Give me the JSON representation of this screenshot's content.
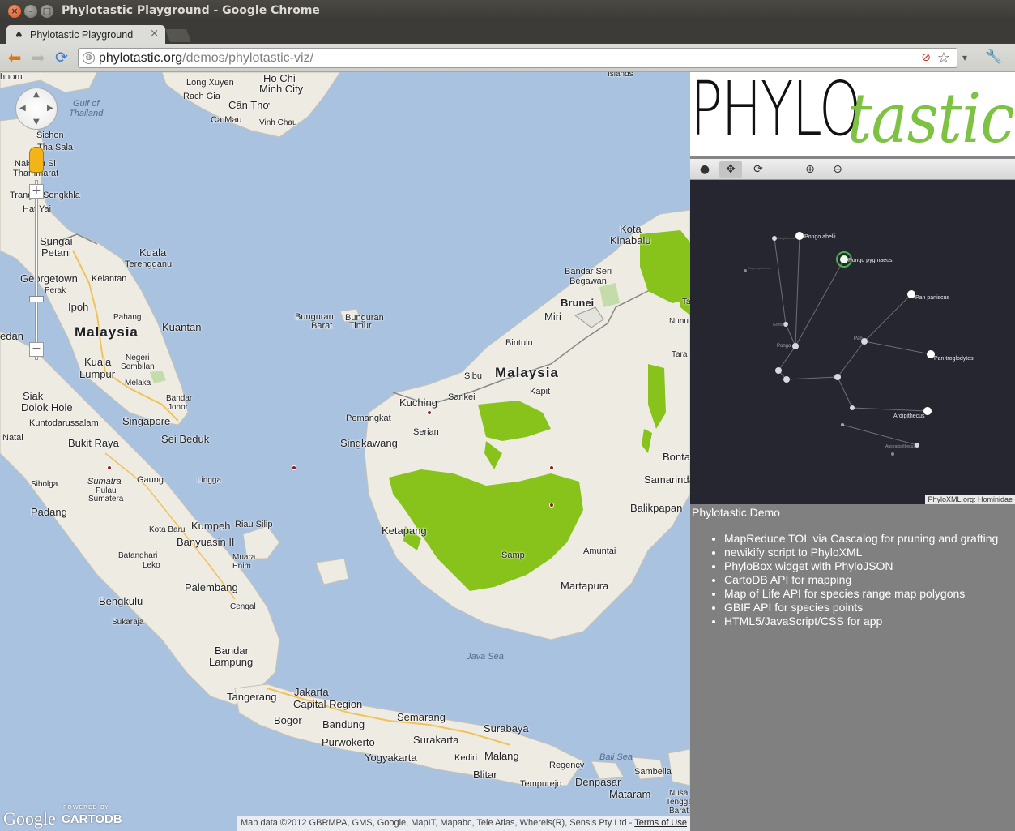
{
  "window": {
    "title": "Phylotastic Playground - Google Chrome",
    "close_glyph": "×",
    "min_glyph": "–",
    "max_glyph": "□"
  },
  "tab": {
    "label": "Phylotastic Playground",
    "icon": "tree-favicon",
    "close_glyph": "×"
  },
  "toolbar": {
    "url_host": "phylotastic.org",
    "url_path": "/demos/phylotastic-viz/",
    "back_glyph": "⬅",
    "forward_glyph": "➡",
    "reload_glyph": "⟳",
    "star_glyph": "☆",
    "dropdown_glyph": "▾",
    "wrench_glyph": "🔧"
  },
  "map": {
    "zoom_in": "+",
    "zoom_out": "−",
    "logo": "Google",
    "powered_by": "POWERED BY",
    "cartodb": "CARTODB",
    "attribution": "Map data ©2012 GBRMPA, GMS, Google, MapIT, Mapabc, Tele Atlas, Whereis(R), Sensis Pty Ltd - ",
    "terms": "Terms of Use",
    "labels": {
      "phnom": "hnom",
      "hochi": "Ho Chi",
      "minhcity": "Minh City",
      "longxuyen": "Long Xuyen",
      "rachgia": "Rach Gia",
      "cantho": "Cần Thơ",
      "camau": "Ca Mau",
      "vinhchau": "Vinh Chau",
      "islands": "Islands",
      "gulf": "Gulf of",
      "thailand": "Thailand",
      "sichon": "Sichon",
      "tasala": "Tha Sala",
      "nakhon": "Nakhon Si",
      "thammarat": "Thammarat",
      "trang": "Trang",
      "songkhla": "Songkhla",
      "hatyai": "Hat Yai",
      "sungai": "Sungai",
      "petani": "Petani",
      "kuala": "Kuala",
      "terengganu": "Terengganu",
      "georgetown": "Georgetown",
      "kelantan": "Kelantan",
      "perak": "Perak",
      "ipoh": "Ipoh",
      "pahang": "Pahang",
      "malaysia_w": "Malaysia",
      "kuantan": "Kuantan",
      "medan": "edan",
      "kuala2": "Kuala",
      "lumpur": "Lumpur",
      "negeri": "Negeri",
      "sembilan": "Sembilan",
      "melaka": "Melaka",
      "bandar": "Bandar",
      "johor": "Johor",
      "siak": "Siak",
      "dolokhole": "Dolok Hole",
      "kuntodarussalam": "Kuntodarussalam",
      "singapore": "Singapore",
      "seibeduk": "Sei Beduk",
      "natal": "Natal",
      "bukitraya": "Bukit Raya",
      "sumatra": "Sumatra",
      "pulau": "Pulau",
      "sumatera": "Sumatera",
      "gaung": "Gaung",
      "lingga": "Lingga",
      "sibolga": "Sibolga",
      "padang": "Padang",
      "kumpeh": "Kumpeh",
      "riau": "Riau Silip",
      "kotabaru": "Kota Baru",
      "banyuasin": "Banyuasin II",
      "batanghari": "Batanghari",
      "leko": "Leko",
      "muara": "Muara",
      "enim": "Enim",
      "palembang": "Palembang",
      "bengkulu": "Bengkulu",
      "cengal": "Cengal",
      "sukaraja": "Sukaraja",
      "bandar2": "Bandar",
      "lampung": "Lampung",
      "tangerang": "Tangerang",
      "jakarta": "Jakarta",
      "capital": "Capital Region",
      "bogor": "Bogor",
      "bandung": "Bandung",
      "purwokerto": "Purwokerto",
      "semarang": "Semarang",
      "surakarta": "Surakarta",
      "yogyakarta": "Yogyakarta",
      "surabaya": "Surabaya",
      "kediri": "Kediri",
      "malang": "Malang",
      "blitar": "Blitar",
      "tempurejo": "Tempurejo",
      "sambelia": "Sambelia",
      "regency": "Regency",
      "denpasar": "Denpasar",
      "nusa": "Nusa",
      "tenggara": "Tenggara",
      "barat": "Barat",
      "mataram": "Mataram",
      "balisea": "Bali Sea",
      "javasea": "Java Sea",
      "bunguranbarat": "Bunguran",
      "barat2": "Barat",
      "bunguran2": "Bunguran",
      "timur": "Timur",
      "kuching": "Kuching",
      "serian": "Serian",
      "sarikei": "Sarikei",
      "sibu": "Sibu",
      "pemangkat": "Pemangkat",
      "singkawang": "Singkawang",
      "kapit": "Kapit",
      "malaysia_e": "Malaysia",
      "bintulu": "Bintulu",
      "miri": "Miri",
      "brunei": "Brunei",
      "bandarseri": "Bandar Seri",
      "begawan": "Begawan",
      "kota": "Kota",
      "kinabalu": "Kinabalu",
      "ketapang": "Ketapang",
      "sampit": "Samp",
      "amuntai": "Amuntai",
      "martapura": "Martapura",
      "balikpapan": "Balikpapan",
      "samarinda": "Samarinda",
      "bontang": "Bonta",
      "nunukan": "Nunu",
      "tarakan": "Tara",
      "berau": "Tan"
    }
  },
  "phylobox": {
    "tools": [
      "select-tool",
      "move-tool",
      "refresh-tool",
      "zoom-in-tool",
      "zoom-out-tool"
    ],
    "tool_glyphs": [
      "●",
      "✥",
      "⟳",
      "⊕",
      "⊖"
    ],
    "credit": "PhyloXML.org: Hominidae",
    "nodes": {
      "pongo_abelii": "Pongo abelii",
      "pongo_pygmaeus": "Pongo pygmaeus",
      "pan_paniscus": "Pan paniscus",
      "pan_troglodytes": "Pan troglodytes",
      "pan": "Pan",
      "pongo": "Pongo",
      "gorilla": "Gorilla",
      "ardipithecus": "Ardipithecus",
      "australopithecus": "Australopithecus",
      "sivapithecus": "Sivapithecus",
      "gigantopithecus": "Gigantopithecus"
    }
  },
  "logo": {
    "part1": "PHYLO",
    "part2": "tastic"
  },
  "demo": {
    "title": "Phylotastic Demo",
    "items": [
      "MapReduce TOL via Cascalog for pruning and grafting",
      "newikify script to PhyloXML",
      "PhyloBox widget with PhyloJSON",
      "CartoDB API for mapping",
      "Map of Life API for species range map polygons",
      "GBIF API for species points",
      "HTML5/JavaScript/CSS for app"
    ]
  }
}
